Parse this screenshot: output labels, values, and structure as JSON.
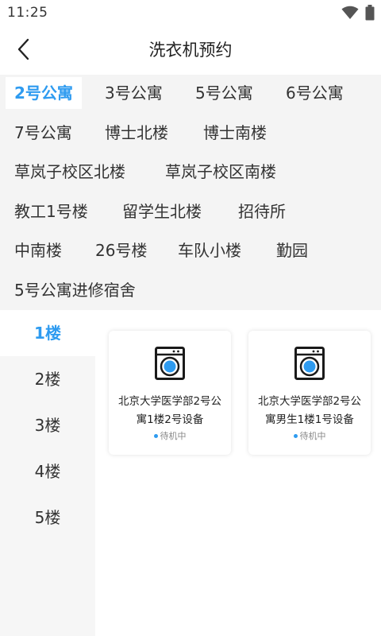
{
  "status_bar": {
    "time": "11:25",
    "wifi_icon": "wifi-icon",
    "battery_icon": "battery-icon"
  },
  "header": {
    "title": "洗衣机预约",
    "back_icon": "chevron-left-icon"
  },
  "buildings": [
    "2号公寓",
    "3号公寓",
    "5号公寓",
    "6号公寓",
    "7号公寓",
    "博士北楼",
    "博士南楼",
    "草岚子校区北楼",
    "草岚子校区南楼",
    "教工1号楼",
    "留学生北楼",
    "招待所",
    "中南楼",
    "26号楼",
    "车队小楼",
    "勤园",
    "5号公寓进修宿舍"
  ],
  "selected_building": "2号公寓",
  "floors": [
    "1楼",
    "2楼",
    "3楼",
    "4楼",
    "5楼"
  ],
  "selected_floor": "1楼",
  "devices": [
    {
      "name": "北京大学医学部2号公寓1楼2号设备",
      "status": "待机中",
      "icon": "washing-machine-icon"
    },
    {
      "name": "北京大学医学部2号公寓男生1楼1号设备",
      "status": "待机中",
      "icon": "washing-machine-icon"
    }
  ],
  "colors": {
    "accent": "#2e9bf0",
    "chip_bg": "#f4f4f4",
    "sidebar_bg": "#f6f6f6"
  }
}
